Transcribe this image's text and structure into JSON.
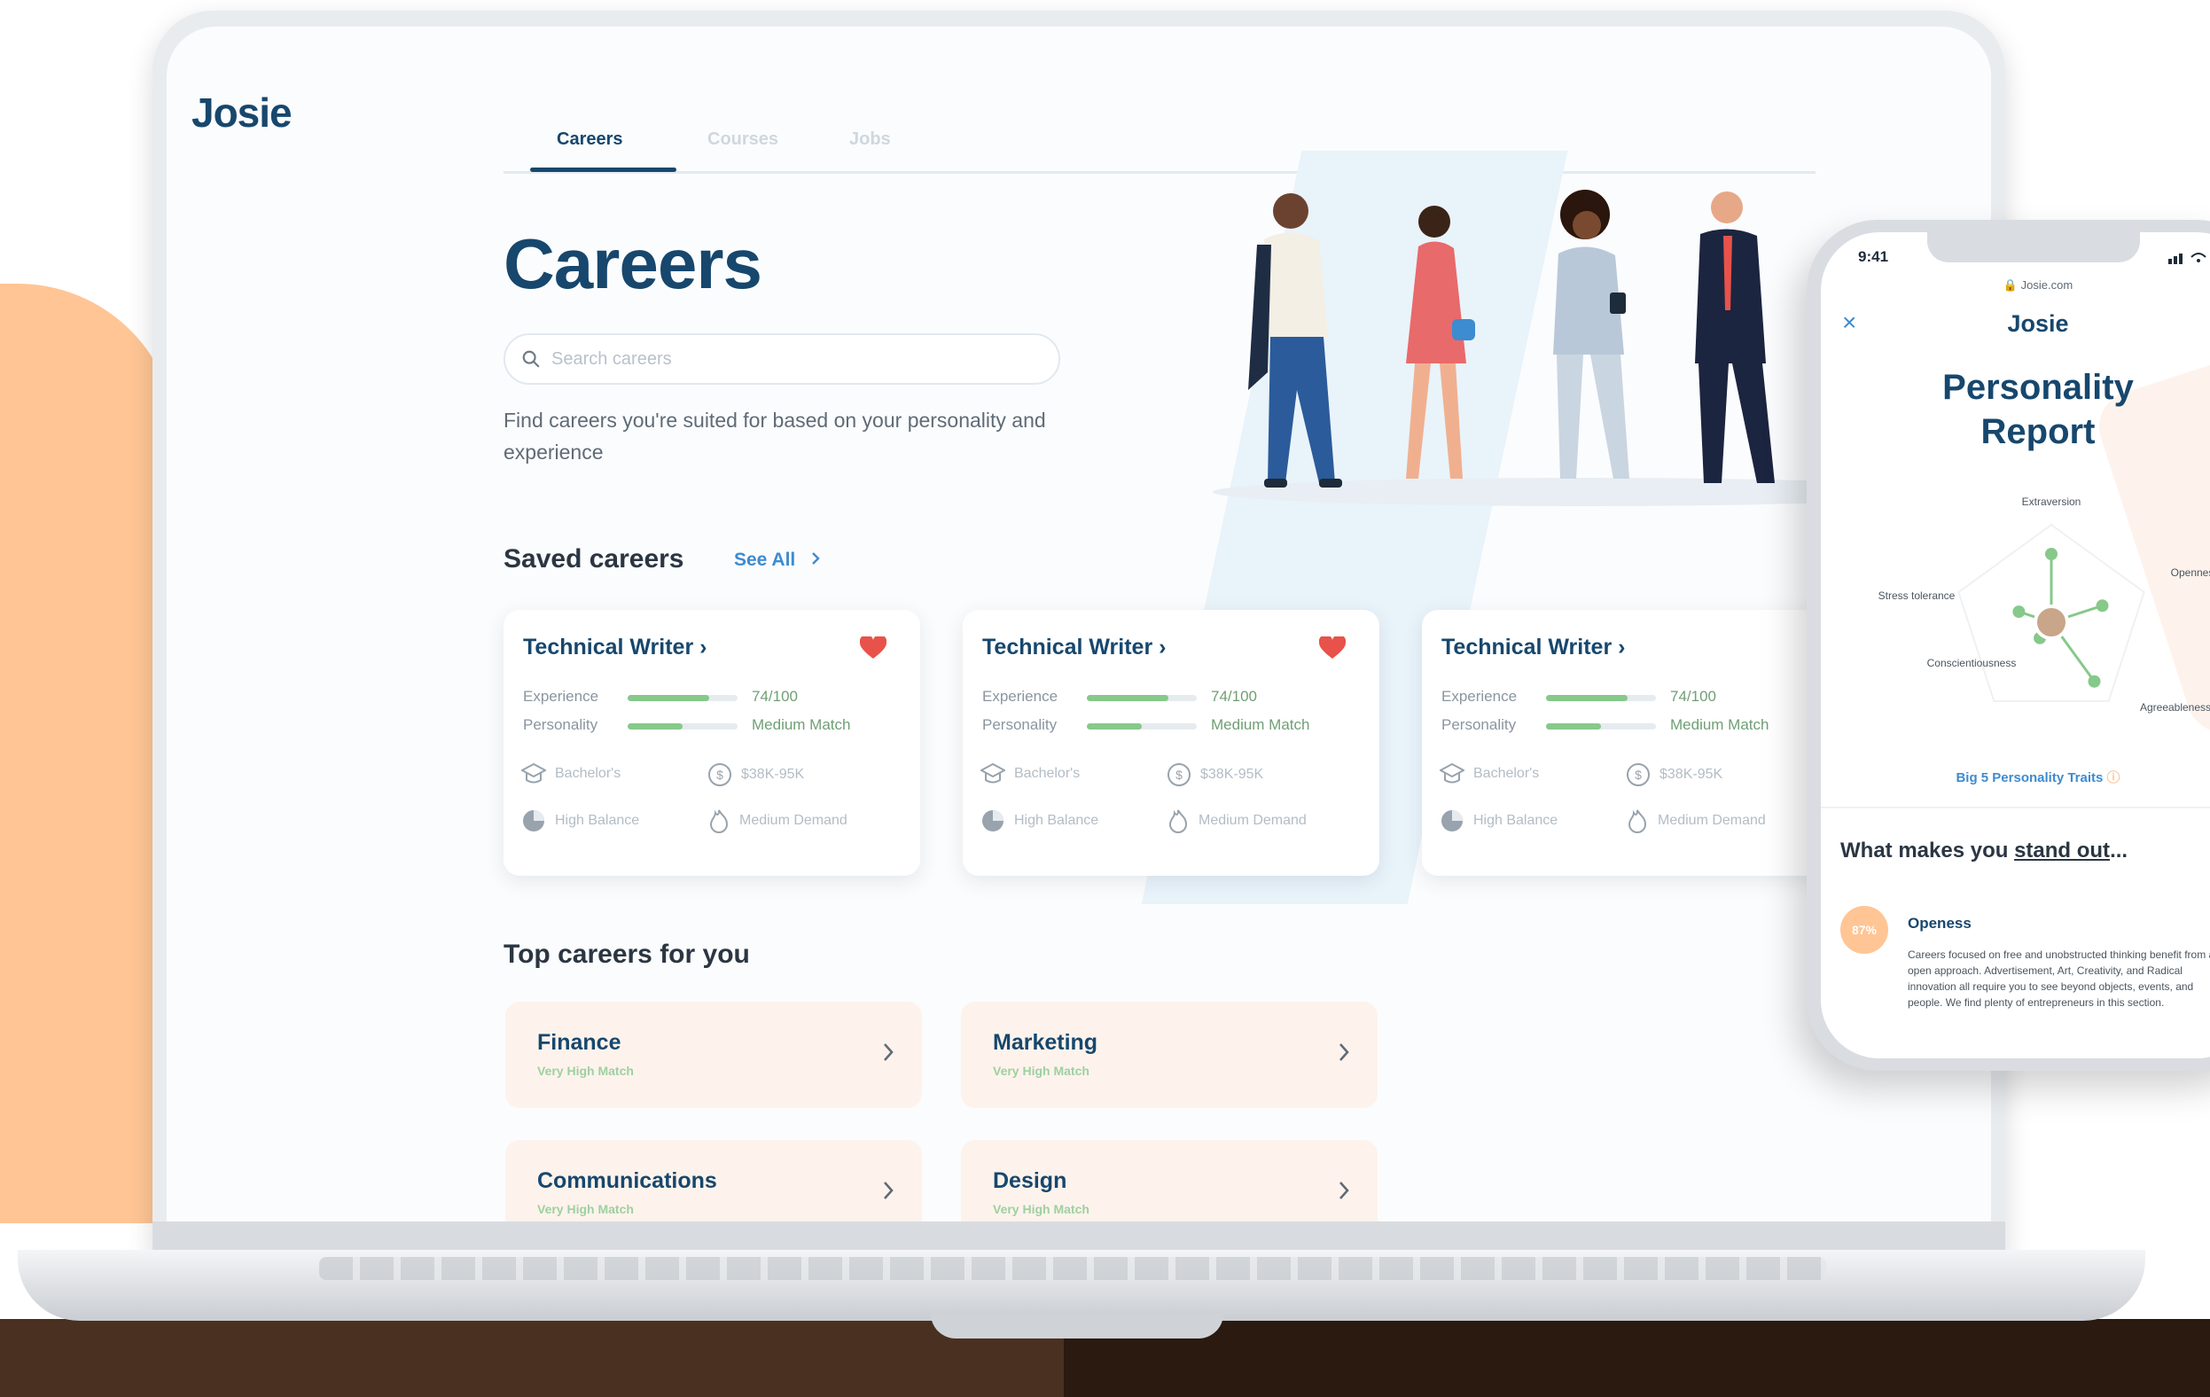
{
  "app": {
    "logo": "Josie"
  },
  "nav": {
    "tabs": [
      {
        "label": "Careers",
        "active": true
      },
      {
        "label": "Courses"
      },
      {
        "label": "Jobs"
      }
    ]
  },
  "hero": {
    "title": "Careers",
    "search_placeholder": "Search careers",
    "subtitle": "Find careers you're suited for based on your personality and experience"
  },
  "saved": {
    "title": "Saved careers",
    "see_all": "See All",
    "cards": [
      {
        "title": "Technical Writer",
        "saved": true,
        "experience_label": "Experience",
        "experience_value": "74/100",
        "experience_level": 0.74,
        "personality_label": "Personality",
        "personality_value": "Medium Match",
        "personality_level": 0.5,
        "education": "Bachelor's",
        "salary": "$38K-95K",
        "balance": "High Balance",
        "demand": "Medium Demand"
      },
      {
        "title": "Technical Writer",
        "saved": true,
        "experience_label": "Experience",
        "experience_value": "74/100",
        "experience_level": 0.74,
        "personality_label": "Personality",
        "personality_value": "Medium Match",
        "personality_level": 0.5,
        "education": "Bachelor's",
        "salary": "$38K-95K",
        "balance": "High Balance",
        "demand": "Medium Demand"
      },
      {
        "title": "Technical Writer",
        "saved": false,
        "experience_label": "Experience",
        "experience_value": "74/100",
        "experience_level": 0.74,
        "personality_label": "Personality",
        "personality_value": "Medium Match",
        "personality_level": 0.5,
        "education": "Bachelor's",
        "salary": "$38K-95K",
        "balance": "High Balance",
        "demand": "Medium Demand"
      }
    ]
  },
  "top": {
    "title": "Top careers for you",
    "cards": [
      {
        "title": "Finance",
        "sub": "Very High Match"
      },
      {
        "title": "Marketing",
        "sub": "Very High Match"
      },
      {
        "title": "Communications",
        "sub": "Very High Match"
      },
      {
        "title": "Design",
        "sub": "Very High Match"
      }
    ]
  },
  "phone": {
    "time": "9:41",
    "url": "Josie.com",
    "logo": "Josie",
    "title_line1": "Personality",
    "title_line2": "Report",
    "traits": [
      {
        "label": "Extraversion",
        "value": 0.7
      },
      {
        "label": "Openness",
        "value": 0.55
      },
      {
        "label": "Agreeableness",
        "value": 0.75
      },
      {
        "label": "Conscientiousness",
        "value": 0.2
      },
      {
        "label": "Stress tolerance",
        "value": 0.35
      }
    ],
    "big5": "Big 5 Personality Traits",
    "standout_prefix": "What makes you ",
    "standout_link": "stand out",
    "standout_suffix": "...",
    "badge": "87%",
    "trait_title": "Openess",
    "trait_desc": "Careers focused on free and unobstructed thinking benefit from an open approach. Advertisement, Art, Creativity, and Radical innovation all require you to see beyond objects, events, and people. We find plenty of entrepreneurs in this section."
  },
  "colors": {
    "brand": "#17476d",
    "accent": "#3d8bd0",
    "peach": "#ffc595",
    "match": "#86c98a",
    "heart": "#e8524a"
  }
}
